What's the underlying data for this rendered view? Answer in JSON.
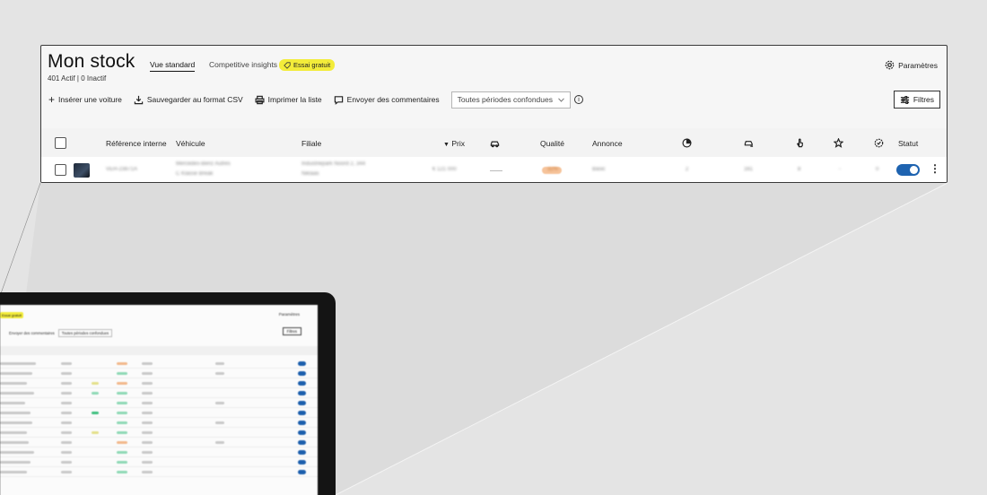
{
  "page": {
    "title": "Mon stock",
    "tabs": [
      {
        "label": "Vue standard"
      },
      {
        "label": "Competitive insights"
      }
    ],
    "trial_badge": "Essai gratuit",
    "counts": "401 Actif  |  0 Inactif",
    "settings_label": "Paramètres"
  },
  "toolbar": {
    "insert_label": "Insérer une voiture",
    "csv_label": "Sauvegarder au format CSV",
    "print_label": "Imprimer la liste",
    "feedback_label": "Envoyer des commentaires",
    "period_value": "Toutes périodes confondues",
    "filters_label": "Filtres"
  },
  "table": {
    "headers": {
      "ref": "Référence interne",
      "vehicle": "Véhicule",
      "branch": "Filiale",
      "price": "Prix",
      "quality": "Qualité",
      "listing": "Annonce",
      "status": "Statut"
    },
    "rows": [
      {
        "ref": "VEH-23871A",
        "vehicle": "Mercedes-Benz Autres",
        "vehicle_sub": "C Klasse Break",
        "branch": "Industriepark Noord 2, 344",
        "branch_sub": "Niklaas",
        "price": "€ 121 000",
        "quality": "32%",
        "listing": "Basic",
        "c1": "2",
        "c2": "161",
        "c3": "8",
        "c4": "-",
        "c5": "0",
        "active": true
      }
    ]
  },
  "mockup": {
    "badge": "Essai gratuit",
    "settings_label": "Paramètres",
    "feedback_label": "Envoyer des commentaires",
    "period_value": "Toutes périodes confondues",
    "filters_label": "Filtres"
  },
  "colors": {
    "accent": "#1e63b0",
    "badge": "#f3ec3a",
    "quality": "#f6c39a",
    "background": "#e4e4e4"
  }
}
